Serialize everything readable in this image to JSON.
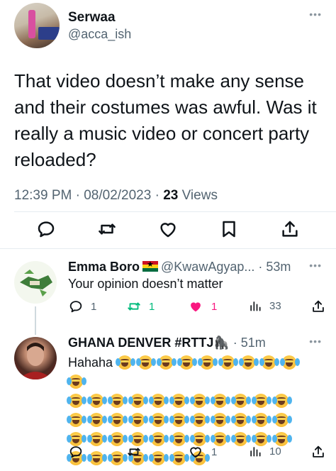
{
  "main_tweet": {
    "name": "Serwaa",
    "handle": "@acca_ish",
    "text": "That video doesn’t make any sense and their costumes was awful.  Was it really a music video or concert party reloaded?",
    "time": "12:39 PM · 08/02/2023 · ",
    "views_count": "23",
    "views_label": " Views",
    "more": "•••"
  },
  "replies": [
    {
      "name": "Emma Boro",
      "handle": "@KwawAgyap... · 53m",
      "text": "Your opinion doesn’t matter",
      "reply_count": "1",
      "retweet_count": "1",
      "like_count": "1",
      "views_count": "33",
      "more": "•••"
    },
    {
      "name": "GHANA DENVER #RTTJ",
      "name_emoji": "🦍",
      "handle": " · 51m",
      "text": "Hahaha",
      "emoji_count_line1": 10,
      "emoji_count_full_lines": 3,
      "emoji_per_line": 11,
      "emoji_count_last_line": 7,
      "reply_count": "",
      "retweet_count": "",
      "like_count": "1",
      "views_count": "10",
      "more": "•••"
    }
  ],
  "colors": {
    "text": "#0f1419",
    "secondary": "#536471",
    "retweet_green": "#00ba7c",
    "like_pink": "#f91880"
  }
}
